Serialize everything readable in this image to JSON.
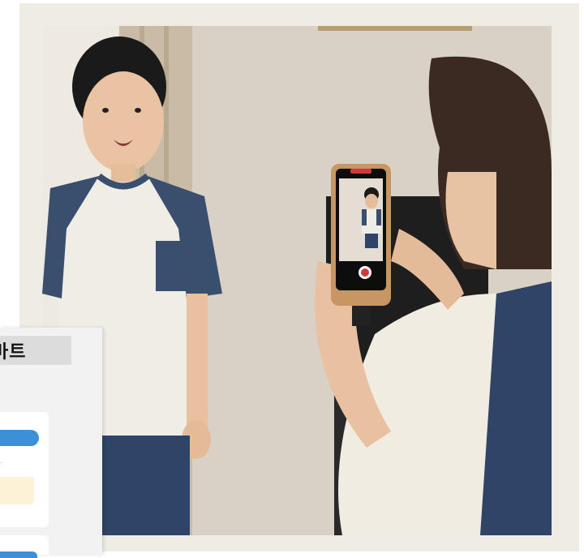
{
  "overlay": {
    "title": "마트",
    "snippet": "·"
  },
  "photo": {
    "subject": "child-being-filmed-with-smartphone-on-tripod",
    "colors": {
      "wall": "#d9d1c5",
      "shirt_body": "#f0ede6",
      "shirt_sleeve": "#3a4f6e",
      "accent": "#3d8fd6"
    }
  }
}
